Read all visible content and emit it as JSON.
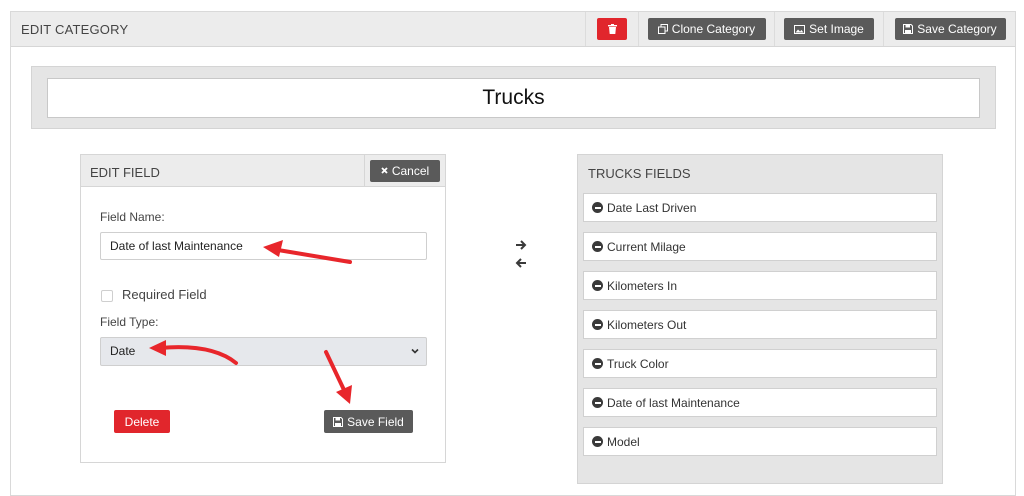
{
  "header": {
    "title": "EDIT CATEGORY",
    "delete_icon": "trash-icon",
    "clone_label": "Clone Category",
    "set_image_label": "Set Image",
    "save_label": "Save Category"
  },
  "category": {
    "name": "Trucks"
  },
  "edit_field": {
    "title": "EDIT FIELD",
    "cancel_label": "Cancel",
    "field_name_label": "Field Name:",
    "field_name_value": "Date of last Maintenance",
    "required_label": "Required Field",
    "required_checked": false,
    "field_type_label": "Field Type:",
    "field_type_value": "Date",
    "delete_label": "Delete",
    "save_label": "Save Field"
  },
  "fields_list": {
    "title": "TRUCKS FIELDS",
    "items": [
      "Date Last Driven",
      "Current Milage",
      "Kilometers In",
      "Kilometers Out",
      "Truck Color",
      "Date of last Maintenance",
      "Model"
    ]
  },
  "colors": {
    "danger": "#e1262c",
    "dark_button": "#5a5a5a",
    "annotation_arrow": "#e8262b"
  }
}
